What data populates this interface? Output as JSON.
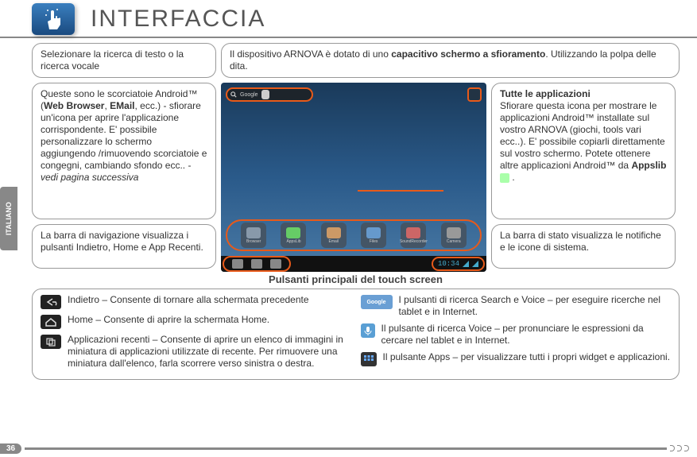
{
  "lang_tab": "ITALIANO",
  "title": "INTERFACCIA",
  "row1": {
    "left": "Selezionare la ricerca di testo o la ricerca vocale",
    "right_pre": "Il dispositivo ARNOVA è dotato di uno ",
    "right_bold": "capacitivo schermo a sfioramento",
    "right_post": ". Utilizzando la polpa delle dita."
  },
  "left_col": {
    "box1_pre": "Queste sono le scorciatoie Android™ (",
    "box1_b1": "Web Browser",
    "box1_mid": ", ",
    "box1_b2": "EMail",
    "box1_post": ", ecc.) - sfiorare un'icona per aprire l'applicazione corrispondente. E' possibile personalizzare lo schermo aggiungendo /rimuovendo scorciatoie e congegni, cambiando sfondo ecc.. - ",
    "box1_em": "vedi pagina successiva",
    "box2": "La barra di navigazione visualizza i pulsanti Indietro, Home e App Recenti."
  },
  "right_col": {
    "box1_title": "Tutte le applicazioni",
    "box1_body_pre": "Sfiorare questa icona per mostrare le applicazioni Android™ installate sul vostro ARNOVA (giochi, tools vari ecc..). E' possibile copiarli direttamente sul vostro schermo. Potete ottenere altre applicazioni Android™ da ",
    "box1_bold": "Appslib",
    "box1_post": " .",
    "box2": "La barra di stato visualizza le notifiche e le icone di sistema."
  },
  "screenshot": {
    "search_text": "Google",
    "clock": "10:34",
    "dock": [
      "Browser",
      "AppsLib",
      "Email",
      "Files",
      "SoundRecorder",
      "Camera"
    ]
  },
  "section_title": "Pulsanti principali del touch screen",
  "bottom": {
    "left": [
      {
        "label": "Indietro – Consente di tornare alla schermata precedente"
      },
      {
        "label": "Home – Consente di aprire la schermata Home."
      },
      {
        "label": "Applicazioni recenti – Consente di aprire un elenco di immagini in miniatura di applicazioni utilizzate di recente. Per rimuovere una miniatura dall'elenco, farla scorrere verso sinistra o destra."
      }
    ],
    "right": [
      {
        "label": "I pulsanti di ricerca Search e Voice – per eseguire ricerche nel tablet e in Internet."
      },
      {
        "label": "Il pulsante di ricerca Voice – per pronunciare le espressioni da cercare nel tablet e in Internet."
      },
      {
        "label": "Il pulsante Apps – per visualizzare tutti i propri widget e applicazioni."
      }
    ]
  },
  "page_number": "36"
}
